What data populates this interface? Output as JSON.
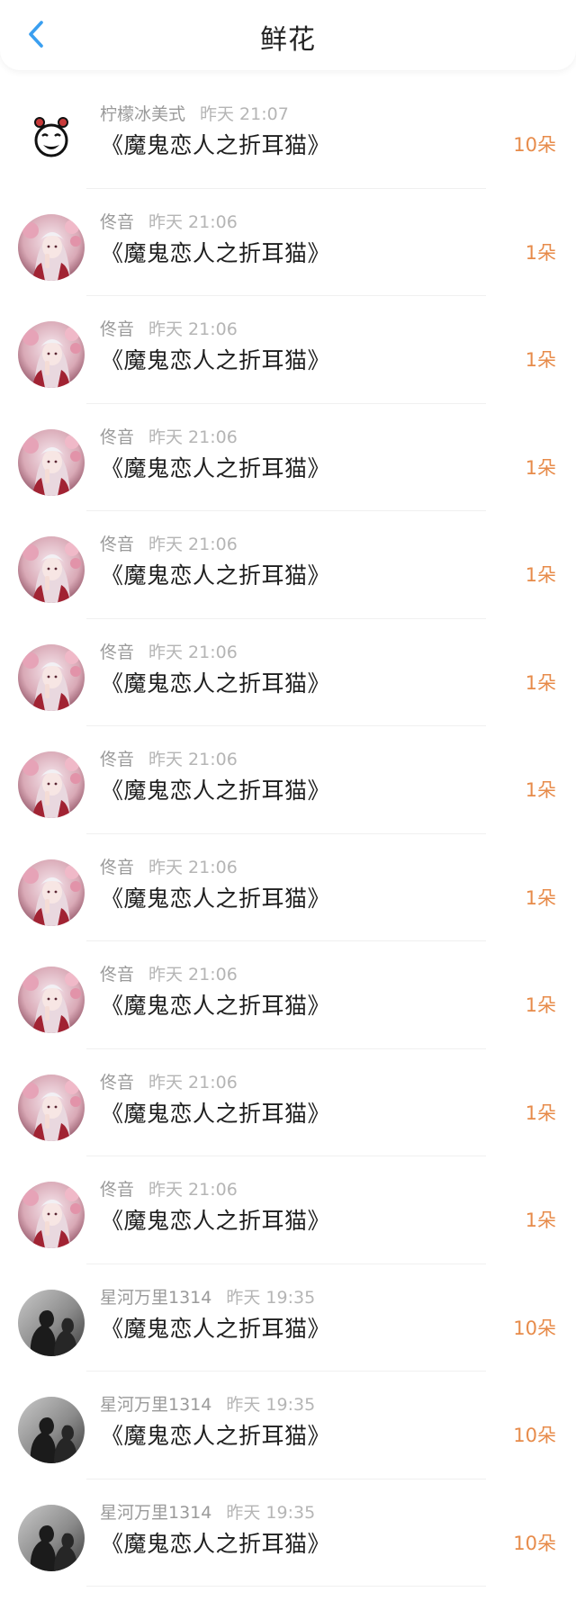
{
  "header": {
    "title": "鲜花",
    "back_icon": "chevron-left-icon",
    "accent": "#3a9ff0"
  },
  "colors": {
    "count": "#e78b4a",
    "username": "#9a9a9a",
    "title": "#1f1f1f"
  },
  "rows": [
    {
      "avatar": "cartoon",
      "username": "柠檬冰美式",
      "time": "昨天 21:07",
      "title": "《魔鬼恋人之折耳猫》",
      "count": "10朵"
    },
    {
      "avatar": "girl",
      "username": "佟音",
      "time": "昨天 21:06",
      "title": "《魔鬼恋人之折耳猫》",
      "count": "1朵"
    },
    {
      "avatar": "girl",
      "username": "佟音",
      "time": "昨天 21:06",
      "title": "《魔鬼恋人之折耳猫》",
      "count": "1朵"
    },
    {
      "avatar": "girl",
      "username": "佟音",
      "time": "昨天 21:06",
      "title": "《魔鬼恋人之折耳猫》",
      "count": "1朵"
    },
    {
      "avatar": "girl",
      "username": "佟音",
      "time": "昨天 21:06",
      "title": "《魔鬼恋人之折耳猫》",
      "count": "1朵"
    },
    {
      "avatar": "girl",
      "username": "佟音",
      "time": "昨天 21:06",
      "title": "《魔鬼恋人之折耳猫》",
      "count": "1朵"
    },
    {
      "avatar": "girl",
      "username": "佟音",
      "time": "昨天 21:06",
      "title": "《魔鬼恋人之折耳猫》",
      "count": "1朵"
    },
    {
      "avatar": "girl",
      "username": "佟音",
      "time": "昨天 21:06",
      "title": "《魔鬼恋人之折耳猫》",
      "count": "1朵"
    },
    {
      "avatar": "girl",
      "username": "佟音",
      "time": "昨天 21:06",
      "title": "《魔鬼恋人之折耳猫》",
      "count": "1朵"
    },
    {
      "avatar": "girl",
      "username": "佟音",
      "time": "昨天 21:06",
      "title": "《魔鬼恋人之折耳猫》",
      "count": "1朵"
    },
    {
      "avatar": "girl",
      "username": "佟音",
      "time": "昨天 21:06",
      "title": "《魔鬼恋人之折耳猫》",
      "count": "1朵"
    },
    {
      "avatar": "silhouette",
      "username": "星河万里1314",
      "time": "昨天 19:35",
      "title": "《魔鬼恋人之折耳猫》",
      "count": "10朵"
    },
    {
      "avatar": "silhouette",
      "username": "星河万里1314",
      "time": "昨天 19:35",
      "title": "《魔鬼恋人之折耳猫》",
      "count": "10朵"
    },
    {
      "avatar": "silhouette",
      "username": "星河万里1314",
      "time": "昨天 19:35",
      "title": "《魔鬼恋人之折耳猫》",
      "count": "10朵"
    }
  ]
}
